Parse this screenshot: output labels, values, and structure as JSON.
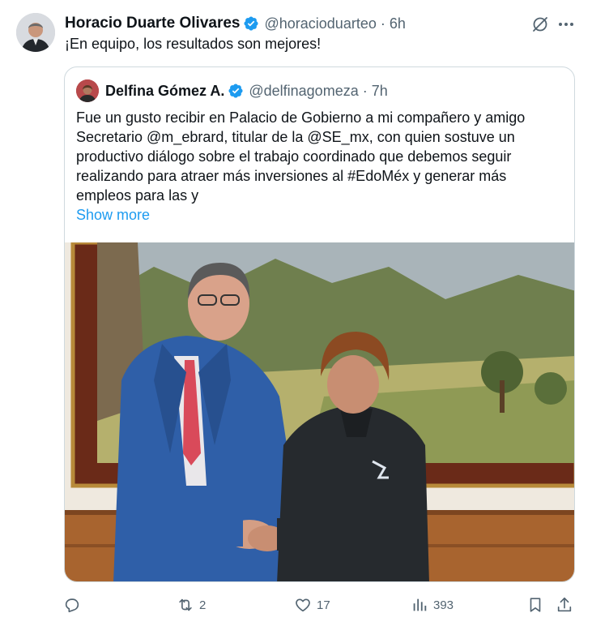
{
  "tweet": {
    "author": {
      "name": "Horacio Duarte Olivares",
      "handle": "@horacioduarteo",
      "time": "6h",
      "separator": "·"
    },
    "text": "¡En equipo, los resultados son mejores!",
    "quoted": {
      "author": {
        "name": "Delfina Gómez A.",
        "handle": "@delfinagomeza",
        "time": "7h",
        "separator": "·"
      },
      "text_lines": [
        "Fue un gusto recibir en Palacio de Gobierno a mi compañero y amigo",
        "Secretario @m_ebrard, titular de la @SE_mx, con quien sostuve un",
        "productivo diálogo sobre el trabajo coordinado que debemos seguir",
        "realizando para atraer más inversiones al #EdoMéx y generar más",
        "empleos para las y"
      ],
      "show_more": "Show more"
    },
    "actions": {
      "replies": "",
      "reposts": "2",
      "likes": "17",
      "views": "393"
    },
    "colors": {
      "accent": "#1d9bf0",
      "muted": "#536471",
      "border": "#cfd9de"
    },
    "icons": [
      "verified-badge-icon",
      "grok-icon",
      "more-icon",
      "reply-icon",
      "repost-icon",
      "like-icon",
      "views-icon",
      "bookmark-icon",
      "share-icon"
    ]
  }
}
